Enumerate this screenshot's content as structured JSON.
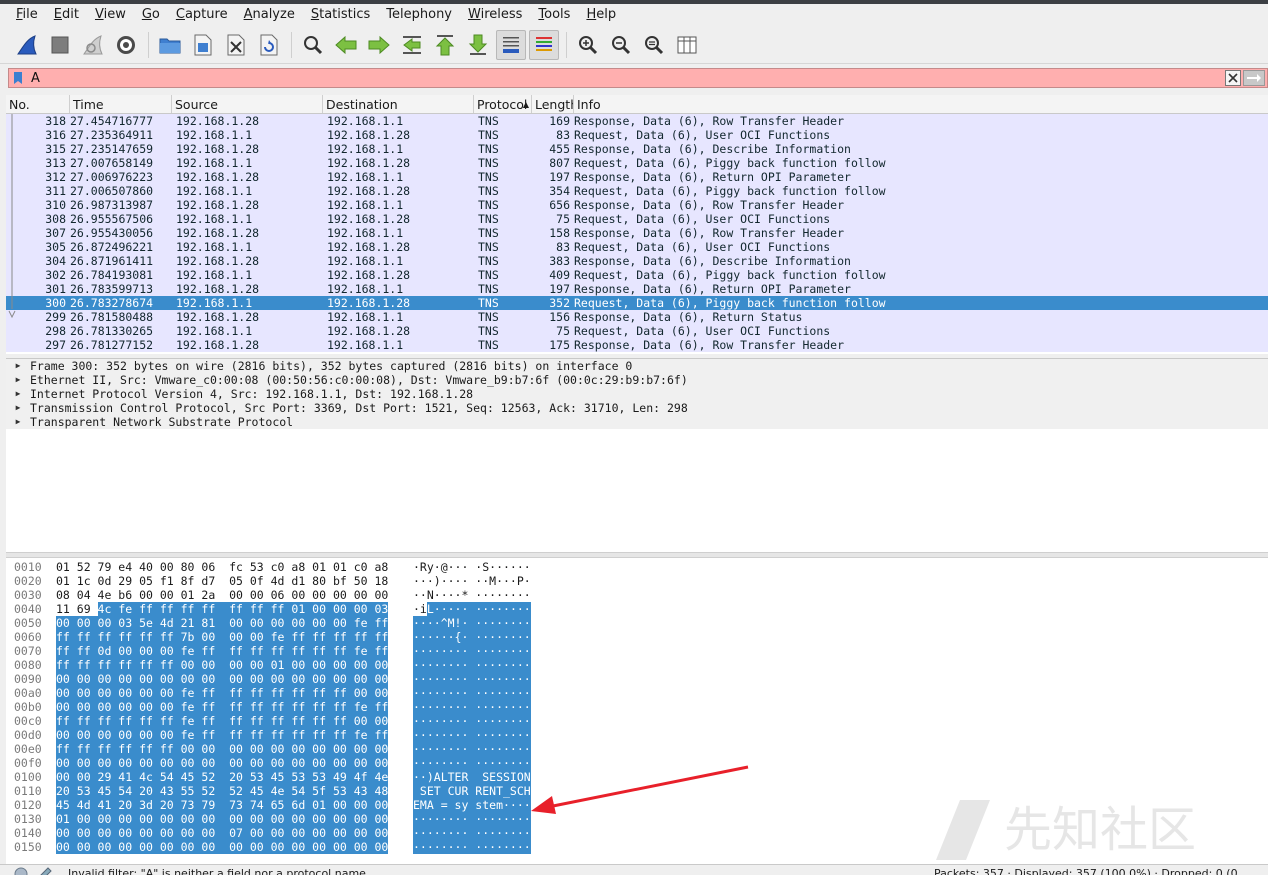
{
  "menu": [
    {
      "label": "File",
      "u": "F",
      "rest": "ile"
    },
    {
      "label": "Edit",
      "u": "E",
      "rest": "dit"
    },
    {
      "label": "View",
      "u": "V",
      "rest": "iew"
    },
    {
      "label": "Go",
      "u": "G",
      "rest": "o"
    },
    {
      "label": "Capture",
      "u": "C",
      "rest": "apture"
    },
    {
      "label": "Analyze",
      "u": "A",
      "rest": "nalyze"
    },
    {
      "label": "Statistics",
      "u": "S",
      "rest": "tatistics"
    },
    {
      "label": "Telephony",
      "u": "",
      "rest": "Telephony"
    },
    {
      "label": "Wireless",
      "u": "W",
      "rest": "ireless"
    },
    {
      "label": "Tools",
      "u": "T",
      "rest": "ools"
    },
    {
      "label": "Help",
      "u": "H",
      "rest": "elp"
    }
  ],
  "filter": {
    "value": "A"
  },
  "columns": [
    "No.",
    "Time",
    "Source",
    "Destination",
    "Protocol",
    "Length",
    "Info"
  ],
  "packets": [
    {
      "no": "318",
      "time": "27.454716777",
      "src": "192.168.1.28",
      "dst": "192.168.1.1",
      "proto": "TNS",
      "len": "169",
      "info": "Response, Data (6), Row Transfer Header"
    },
    {
      "no": "316",
      "time": "27.235364911",
      "src": "192.168.1.1",
      "dst": "192.168.1.28",
      "proto": "TNS",
      "len": "83",
      "info": "Request, Data (6), User OCI Functions"
    },
    {
      "no": "315",
      "time": "27.235147659",
      "src": "192.168.1.28",
      "dst": "192.168.1.1",
      "proto": "TNS",
      "len": "455",
      "info": "Response, Data (6), Describe Information"
    },
    {
      "no": "313",
      "time": "27.007658149",
      "src": "192.168.1.1",
      "dst": "192.168.1.28",
      "proto": "TNS",
      "len": "807",
      "info": "Request, Data (6), Piggy back function follow"
    },
    {
      "no": "312",
      "time": "27.006976223",
      "src": "192.168.1.28",
      "dst": "192.168.1.1",
      "proto": "TNS",
      "len": "197",
      "info": "Response, Data (6), Return OPI Parameter"
    },
    {
      "no": "311",
      "time": "27.006507860",
      "src": "192.168.1.1",
      "dst": "192.168.1.28",
      "proto": "TNS",
      "len": "354",
      "info": "Request, Data (6), Piggy back function follow"
    },
    {
      "no": "310",
      "time": "26.987313987",
      "src": "192.168.1.28",
      "dst": "192.168.1.1",
      "proto": "TNS",
      "len": "656",
      "info": "Response, Data (6), Row Transfer Header"
    },
    {
      "no": "308",
      "time": "26.955567506",
      "src": "192.168.1.1",
      "dst": "192.168.1.28",
      "proto": "TNS",
      "len": "75",
      "info": "Request, Data (6), User OCI Functions"
    },
    {
      "no": "307",
      "time": "26.955430056",
      "src": "192.168.1.28",
      "dst": "192.168.1.1",
      "proto": "TNS",
      "len": "158",
      "info": "Response, Data (6), Row Transfer Header"
    },
    {
      "no": "305",
      "time": "26.872496221",
      "src": "192.168.1.1",
      "dst": "192.168.1.28",
      "proto": "TNS",
      "len": "83",
      "info": "Request, Data (6), User OCI Functions"
    },
    {
      "no": "304",
      "time": "26.871961411",
      "src": "192.168.1.28",
      "dst": "192.168.1.1",
      "proto": "TNS",
      "len": "383",
      "info": "Response, Data (6), Describe Information"
    },
    {
      "no": "302",
      "time": "26.784193081",
      "src": "192.168.1.1",
      "dst": "192.168.1.28",
      "proto": "TNS",
      "len": "409",
      "info": "Request, Data (6), Piggy back function follow"
    },
    {
      "no": "301",
      "time": "26.783599713",
      "src": "192.168.1.28",
      "dst": "192.168.1.1",
      "proto": "TNS",
      "len": "197",
      "info": "Response, Data (6), Return OPI Parameter"
    },
    {
      "no": "300",
      "time": "26.783278674",
      "src": "192.168.1.1",
      "dst": "192.168.1.28",
      "proto": "TNS",
      "len": "352",
      "info": "Request, Data (6), Piggy back function follow",
      "selected": true
    },
    {
      "no": "299",
      "time": "26.781580488",
      "src": "192.168.1.28",
      "dst": "192.168.1.1",
      "proto": "TNS",
      "len": "156",
      "info": "Response, Data (6), Return Status"
    },
    {
      "no": "298",
      "time": "26.781330265",
      "src": "192.168.1.1",
      "dst": "192.168.1.28",
      "proto": "TNS",
      "len": "75",
      "info": "Request, Data (6), User OCI Functions"
    },
    {
      "no": "297",
      "time": "26.781277152",
      "src": "192.168.1.28",
      "dst": "192.168.1.1",
      "proto": "TNS",
      "len": "175",
      "info": "Response, Data (6), Row Transfer Header"
    }
  ],
  "details": [
    "Frame 300: 352 bytes on wire (2816 bits), 352 bytes captured (2816 bits) on interface 0",
    "Ethernet II, Src: Vmware_c0:00:08 (00:50:56:c0:00:08), Dst: Vmware_b9:b7:6f (00:0c:29:b9:b7:6f)",
    "Internet Protocol Version 4, Src: 192.168.1.1, Dst: 192.168.1.28",
    "Transmission Control Protocol, Src Port: 3369, Dst Port: 1521, Seq: 12563, Ack: 31710, Len: 298",
    "Transparent Network Substrate Protocol"
  ],
  "bytes": [
    {
      "off": "0010",
      "hex": "01 52 79 e4 40 00 80 06  fc 53 c0 a8 01 01 c0 a8",
      "asc": "·Ry·@··· ·S······",
      "hlFrom": -1
    },
    {
      "off": "0020",
      "hex": "01 1c 0d 29 05 f1 8f d7  05 0f 4d d1 80 bf 50 18",
      "asc": "···)···· ··M···P·",
      "hlFrom": -1
    },
    {
      "off": "0030",
      "hex": "08 04 4e b6 00 00 01 2a  00 00 06 00 00 00 00 00",
      "asc": "··N····* ········",
      "hlFrom": -1
    },
    {
      "off": "0040",
      "hex": "11 69 4c fe ff ff ff ff  ff ff ff 01 00 00 00 03",
      "asc": "·iL····· ········",
      "hlFrom": 2
    },
    {
      "off": "0050",
      "hex": "00 00 00 03 5e 4d 21 81  00 00 00 00 00 00 fe ff",
      "asc": "····^M!· ········",
      "hlFrom": 0
    },
    {
      "off": "0060",
      "hex": "ff ff ff ff ff ff 7b 00  00 00 fe ff ff ff ff ff",
      "asc": "······{· ········",
      "hlFrom": 0
    },
    {
      "off": "0070",
      "hex": "ff ff 0d 00 00 00 fe ff  ff ff ff ff ff ff fe ff",
      "asc": "········ ········",
      "hlFrom": 0
    },
    {
      "off": "0080",
      "hex": "ff ff ff ff ff ff 00 00  00 00 01 00 00 00 00 00",
      "asc": "········ ········",
      "hlFrom": 0
    },
    {
      "off": "0090",
      "hex": "00 00 00 00 00 00 00 00  00 00 00 00 00 00 00 00",
      "asc": "········ ········",
      "hlFrom": 0
    },
    {
      "off": "00a0",
      "hex": "00 00 00 00 00 00 fe ff  ff ff ff ff ff ff 00 00",
      "asc": "········ ········",
      "hlFrom": 0
    },
    {
      "off": "00b0",
      "hex": "00 00 00 00 00 00 fe ff  ff ff ff ff ff ff fe ff",
      "asc": "········ ········",
      "hlFrom": 0
    },
    {
      "off": "00c0",
      "hex": "ff ff ff ff ff ff fe ff  ff ff ff ff ff ff 00 00",
      "asc": "········ ········",
      "hlFrom": 0
    },
    {
      "off": "00d0",
      "hex": "00 00 00 00 00 00 fe ff  ff ff ff ff ff ff fe ff",
      "asc": "········ ········",
      "hlFrom": 0
    },
    {
      "off": "00e0",
      "hex": "ff ff ff ff ff ff 00 00  00 00 00 00 00 00 00 00",
      "asc": "········ ········",
      "hlFrom": 0
    },
    {
      "off": "00f0",
      "hex": "00 00 00 00 00 00 00 00  00 00 00 00 00 00 00 00",
      "asc": "········ ········",
      "hlFrom": 0
    },
    {
      "off": "0100",
      "hex": "00 00 29 41 4c 54 45 52  20 53 45 53 53 49 4f 4e",
      "asc": "··)ALTER  SESSION",
      "hlFrom": 0
    },
    {
      "off": "0110",
      "hex": "20 53 45 54 20 43 55 52  52 45 4e 54 5f 53 43 48",
      "asc": " SET CUR RENT_SCH",
      "hlFrom": 0
    },
    {
      "off": "0120",
      "hex": "45 4d 41 20 3d 20 73 79  73 74 65 6d 01 00 00 00",
      "asc": "EMA = sy stem····",
      "hlFrom": 0
    },
    {
      "off": "0130",
      "hex": "01 00 00 00 00 00 00 00  00 00 00 00 00 00 00 00",
      "asc": "········ ········",
      "hlFrom": 0
    },
    {
      "off": "0140",
      "hex": "00 00 00 00 00 00 00 00  07 00 00 00 00 00 00 00",
      "asc": "········ ········",
      "hlFrom": 0
    },
    {
      "off": "0150",
      "hex": "00 00 00 00 00 00 00 00  00 00 00 00 00 00 00 00",
      "asc": "········ ········",
      "hlFrom": 0
    }
  ],
  "status": {
    "left": "Invalid filter: \"A\" is neither a field nor a protocol name.",
    "right": "Packets: 357 · Displayed: 357 (100.0%) · Dropped: 0 (0"
  },
  "watermark": {
    "text": "先知社区"
  },
  "colors": {
    "selection": "#3a8ccc",
    "row_bg": "#e7e6ff",
    "filter_invalid": "#ffafaf",
    "annotation_arrow": "#e8202a"
  }
}
